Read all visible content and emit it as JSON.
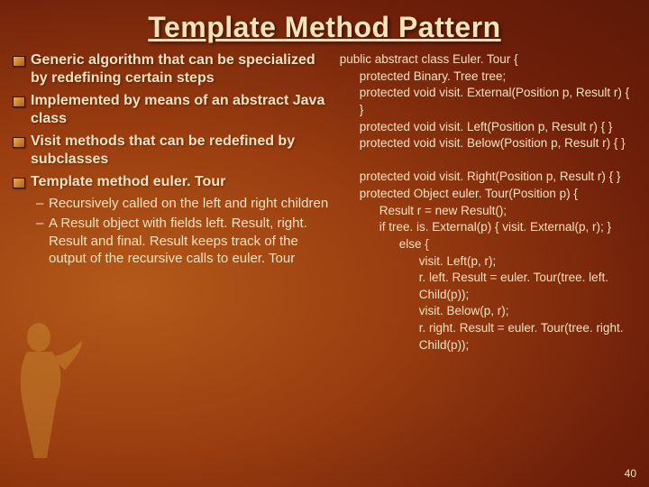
{
  "title": "Template Method Pattern",
  "bullets": [
    "Generic algorithm that can be specialized by redefining certain steps",
    "Implemented by means of an abstract Java class",
    "Visit methods that can be redefined by subclasses",
    "Template method euler. Tour"
  ],
  "sub_bullets": [
    "Recursively called on the left and right children",
    "A Result object with fields left. Result, right. Result and final. Result keeps track of the output of the recursive calls to euler. Tour"
  ],
  "code": {
    "l0": "public abstract class Euler. Tour {",
    "l1": "protected Binary. Tree tree;",
    "l2": "protected void visit. External(Position p, Result r) { }",
    "l3": "protected void visit. Left(Position p, Result r) { }",
    "l4": "protected void visit. Below(Position p, Result r) { }",
    "l5": "protected void visit. Right(Position p, Result r) { }",
    "l6": "protected Object euler. Tour(Position p) {",
    "l7": "Result r = new Result();",
    "l8": "if tree. is. External(p) { visit. External(p, r); }",
    "l9": "else {",
    "l10": "visit. Left(p, r);",
    "l11": "r. left. Result = euler. Tour(tree. left. Child(p));",
    "l12": "visit. Below(p, r);",
    "l13": "r. right. Result = euler. Tour(tree. right. Child(p));"
  },
  "page_number": "40"
}
